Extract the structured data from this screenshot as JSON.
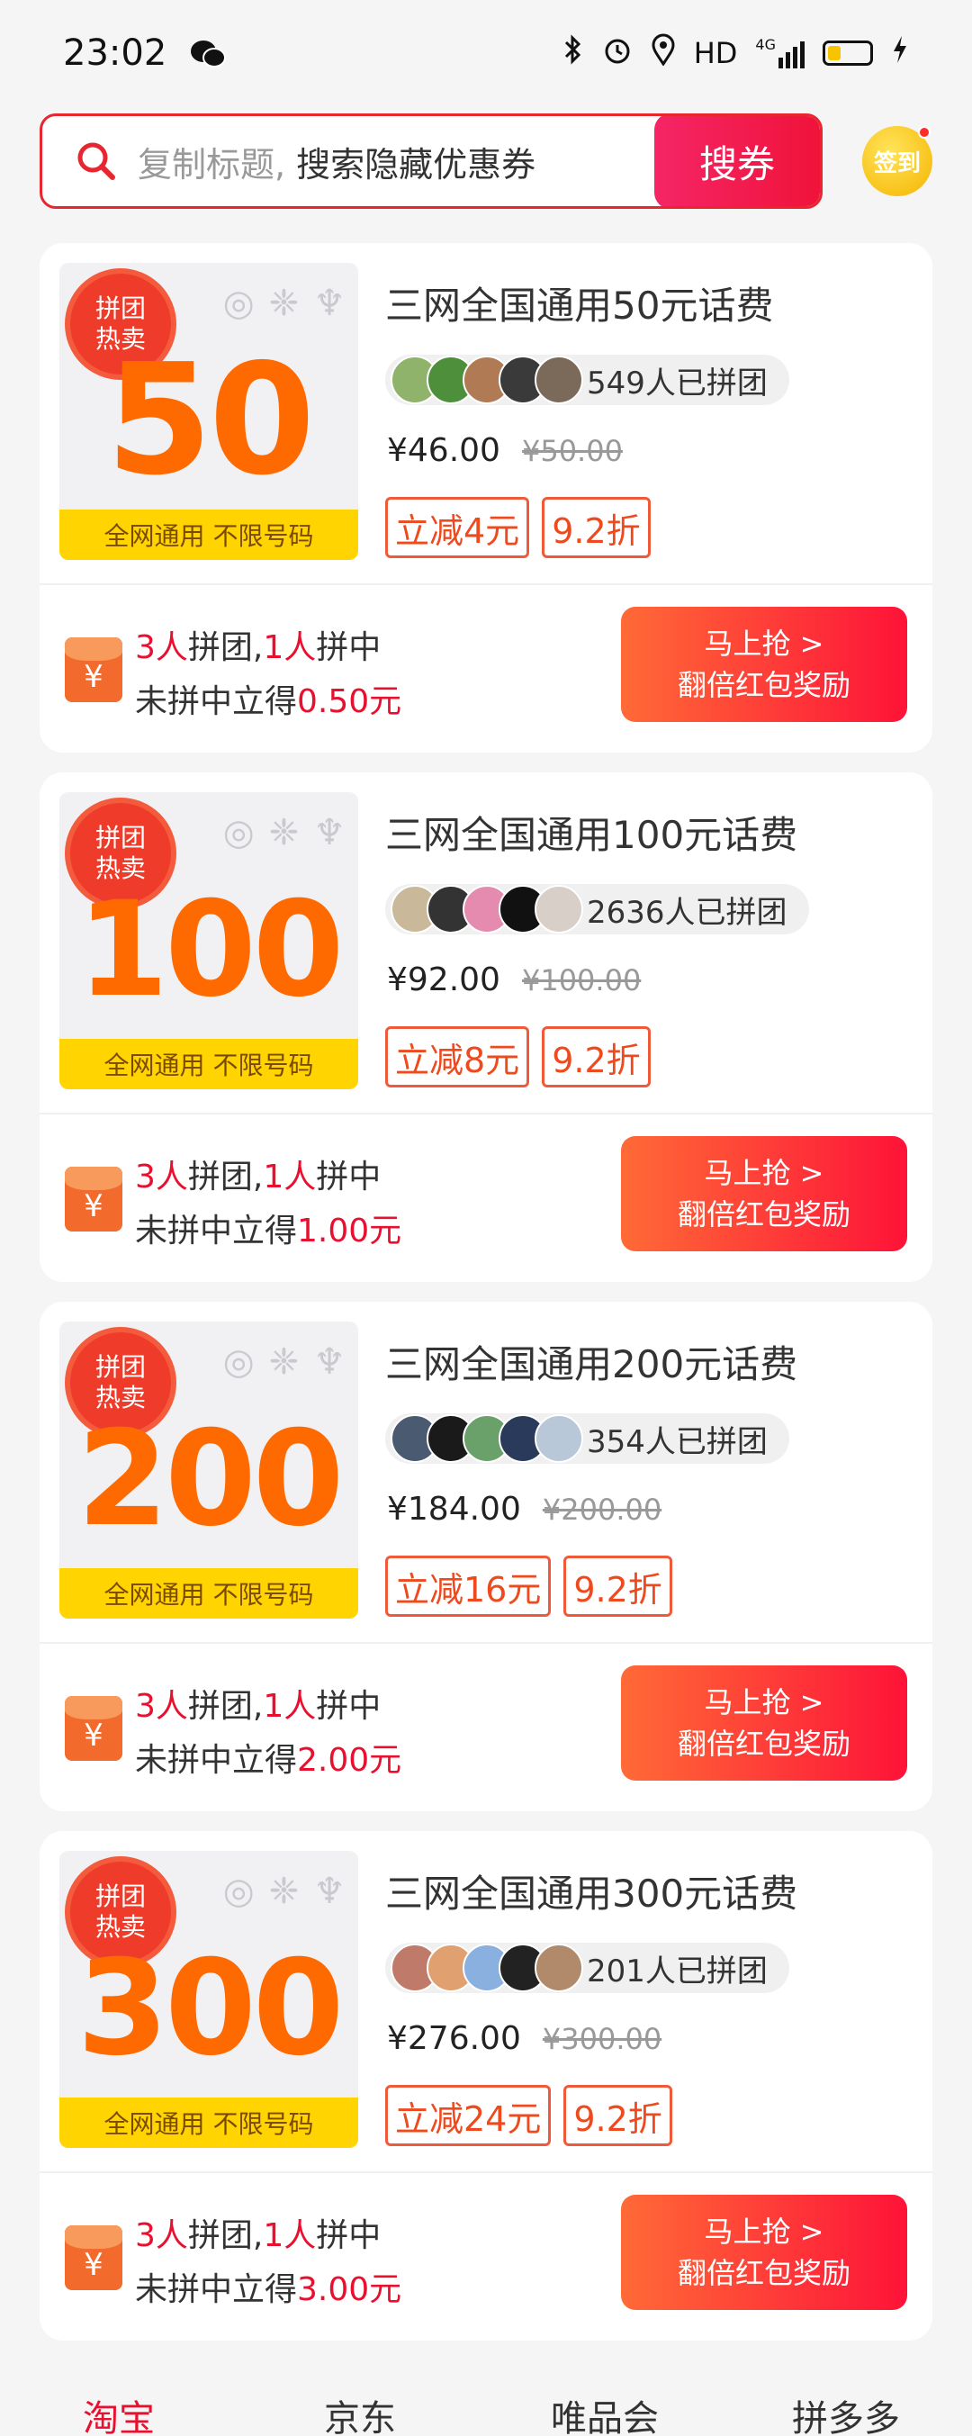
{
  "status_bar": {
    "time": "23:02",
    "network": "HD",
    "signal": "4G"
  },
  "search": {
    "placeholder_prefix": "复制标题,",
    "placeholder_main": "搜索隐藏优惠券",
    "button": "搜券"
  },
  "signin": {
    "label": "签到"
  },
  "cards": [
    {
      "badge": [
        "拼团",
        "热卖"
      ],
      "number": "50",
      "footer": "全网通用 不限号码",
      "title": "三网全国通用50元话费",
      "joined": "549人已拼团",
      "price": "¥46.00",
      "original_price": "¥50.00",
      "tag_discount": "立减4元",
      "tag_rate": "9.2折",
      "team": "3人",
      "team_suffix": "拼团,",
      "win": "1人",
      "win_suffix": "拼中",
      "reward_prefix": "未拼中立得",
      "reward": "0.50元",
      "button_top": "马上抢 >",
      "button_bottom": "翻倍红包奖励"
    },
    {
      "badge": [
        "拼团",
        "热卖"
      ],
      "number": "100",
      "footer": "全网通用 不限号码",
      "title": "三网全国通用100元话费",
      "joined": "2636人已拼团",
      "price": "¥92.00",
      "original_price": "¥100.00",
      "tag_discount": "立减8元",
      "tag_rate": "9.2折",
      "team": "3人",
      "team_suffix": "拼团,",
      "win": "1人",
      "win_suffix": "拼中",
      "reward_prefix": "未拼中立得",
      "reward": "1.00元",
      "button_top": "马上抢 >",
      "button_bottom": "翻倍红包奖励"
    },
    {
      "badge": [
        "拼团",
        "热卖"
      ],
      "number": "200",
      "footer": "全网通用 不限号码",
      "title": "三网全国通用200元话费",
      "joined": "354人已拼团",
      "price": "¥184.00",
      "original_price": "¥200.00",
      "tag_discount": "立减16元",
      "tag_rate": "9.2折",
      "team": "3人",
      "team_suffix": "拼团,",
      "win": "1人",
      "win_suffix": "拼中",
      "reward_prefix": "未拼中立得",
      "reward": "2.00元",
      "button_top": "马上抢 >",
      "button_bottom": "翻倍红包奖励"
    },
    {
      "badge": [
        "拼团",
        "热卖"
      ],
      "number": "300",
      "footer": "全网通用 不限号码",
      "title": "三网全国通用300元话费",
      "joined": "201人已拼团",
      "price": "¥276.00",
      "original_price": "¥300.00",
      "tag_discount": "立减24元",
      "tag_rate": "9.2折",
      "team": "3人",
      "team_suffix": "拼团,",
      "win": "1人",
      "win_suffix": "拼中",
      "reward_prefix": "未拼中立得",
      "reward": "3.00元",
      "button_top": "马上抢 >",
      "button_bottom": "翻倍红包奖励"
    }
  ],
  "tabs": [
    "淘宝",
    "京东",
    "唯品会",
    "拼多多"
  ],
  "colors": {
    "accent": "#e8102e",
    "number": "#ff6a00",
    "footer": "#ffd400"
  }
}
